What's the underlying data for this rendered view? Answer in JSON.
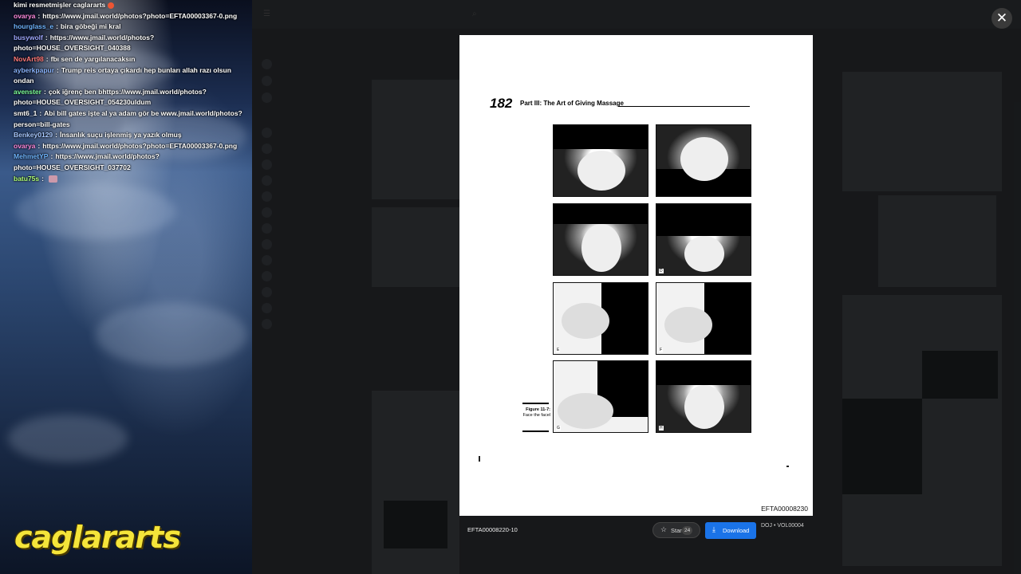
{
  "chat": [
    {
      "user": "",
      "message": "kimi resmetmişler caglararts",
      "user_color": "#ffffff",
      "has_badge": true
    },
    {
      "user": "ovarya",
      "message": "https://www.jmail.world/photos?photo=EFTA00003367-0.png",
      "user_color": "#ff8be0"
    },
    {
      "user": "hourglass_e",
      "message": "bira göbeği mi kral",
      "user_color": "#6fb5ff"
    },
    {
      "user": "busywolf",
      "message": "https://www.jmail.world/photos?photo=HOUSE_OVERSIGHT_040388",
      "user_color": "#9fa8ff"
    },
    {
      "user": "NovArt98",
      "message": "fbı sen de yargılanacaksın",
      "user_color": "#ff7a7a"
    },
    {
      "user": "ayberkpapur",
      "message": "Trump reis ortaya çıkardı hep bunları allah razı olsun ondan",
      "user_color": "#8ab4ff"
    },
    {
      "user": "avenster",
      "message": "çok iğrenç ben bhttps://www.jmail.world/photos?photo=HOUSE_OVERSIGHT_054230uldum",
      "user_color": "#7dff9a"
    },
    {
      "user": "smt6_1",
      "message": "Abi bill gates işte al ya adam gör be www.jmail.world/photos?person=bill-gates",
      "user_color": "#ffffff"
    },
    {
      "user": "Benkey0129",
      "message": "İnsanlık suçu işlenmiş ya yazık olmuş",
      "user_color": "#a8c8ff"
    },
    {
      "user": "ovarya",
      "message": "https://www.jmail.world/photos?photo=EFTA00003367-0.png",
      "user_color": "#ff8be0"
    },
    {
      "user": "MehmetYP",
      "message": "https://www.jmail.world/photos?photo=HOUSE_OVERSIGHT_037702",
      "user_color": "#6fb5ff"
    },
    {
      "user": "batu75s",
      "message": "",
      "user_color": "#b0ff7a",
      "has_emote": true
    }
  ],
  "logo_text": "caglararts",
  "viewer": {
    "page_number": "182",
    "page_header": "Part III: The Art of Giving Massage",
    "figure_letters": [
      "",
      "",
      "",
      "D",
      "E",
      "F",
      "G",
      "H"
    ],
    "caption_title": "Figure 11-7:",
    "caption_text": "Face the facel",
    "doc_id": "EFTA00008230",
    "file_name": "EFTA00008220-10",
    "star_label": "Star",
    "star_count": "24",
    "download_label": "Download",
    "source_label": "DOJ • VOL00004",
    "close_symbol": "✕"
  },
  "icons": {
    "close": "close-icon",
    "star": "star-icon",
    "download": "download-icon"
  },
  "colors": {
    "accent": "#1a73e8",
    "logo": "#f5e53a"
  }
}
